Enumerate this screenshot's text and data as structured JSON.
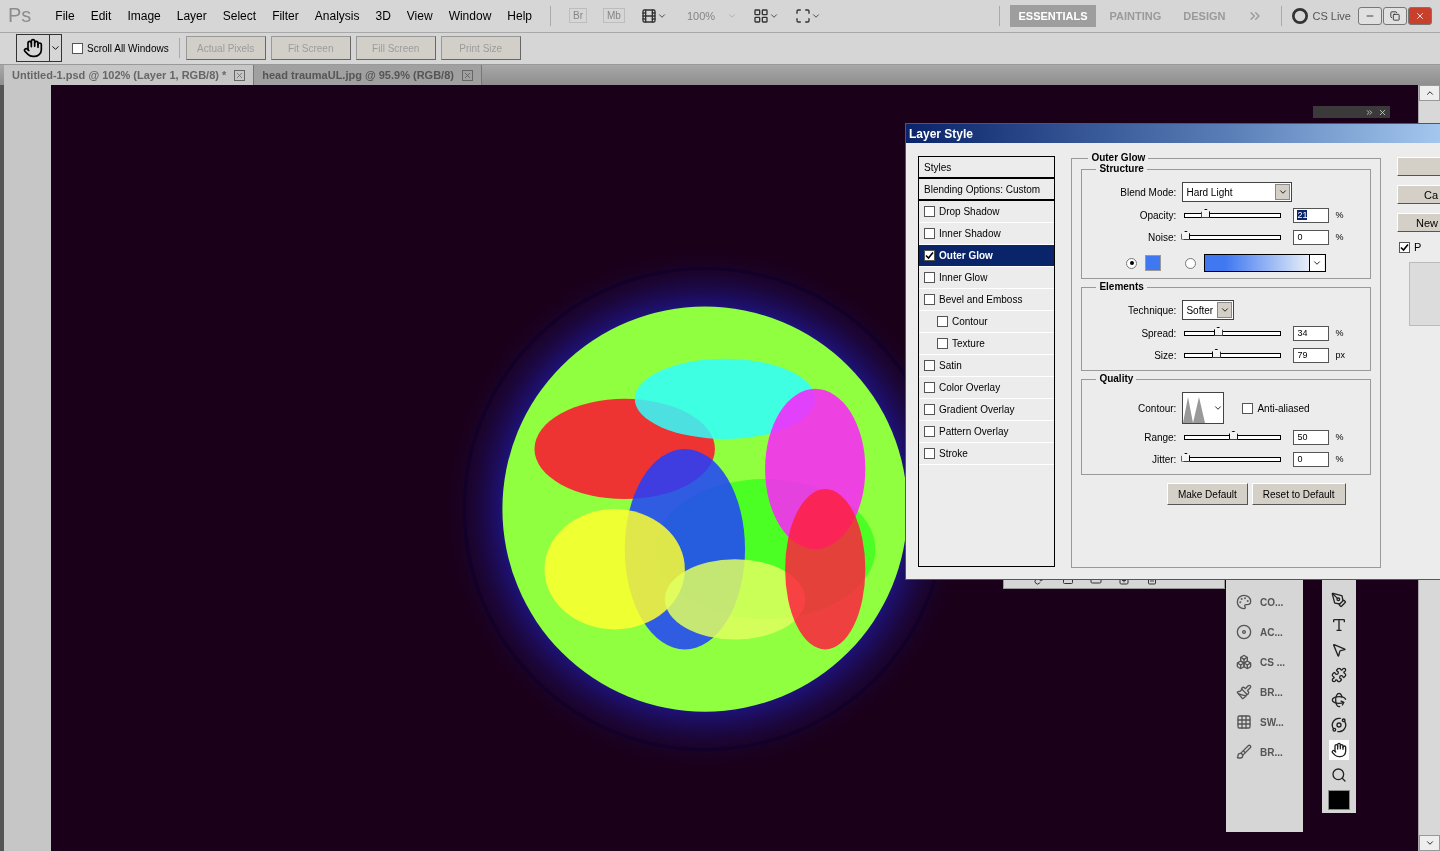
{
  "app": {
    "logo": "Ps",
    "menu": [
      "File",
      "Edit",
      "Image",
      "Layer",
      "Select",
      "Filter",
      "Analysis",
      "3D",
      "View",
      "Window",
      "Help"
    ],
    "bridge_buttons": [
      {
        "label": "Br",
        "disabled": true
      },
      {
        "label": "Mb",
        "disabled": true
      }
    ],
    "zoom": {
      "value": "100%",
      "disabled": true
    },
    "workspaces": [
      {
        "label": "ESSENTIALS",
        "selected": true
      },
      {
        "label": "PAINTING",
        "selected": false
      },
      {
        "label": "DESIGN",
        "selected": false
      }
    ],
    "cs_live": "CS Live"
  },
  "options_bar": {
    "scroll_all_windows": {
      "label": "Scroll All Windows",
      "checked": false
    },
    "buttons": [
      {
        "label": "Actual Pixels",
        "disabled": true
      },
      {
        "label": "Fit Screen",
        "disabled": true
      },
      {
        "label": "Fill Screen",
        "disabled": true
      },
      {
        "label": "Print Size",
        "disabled": true
      }
    ]
  },
  "tabs": [
    {
      "label": "Untitled-1.psd @ 102% (Layer 1, RGB/8) *",
      "selected": true
    },
    {
      "label": "head traumaUL.jpg @ 95.9% (RGB/8)",
      "selected": false
    }
  ],
  "dialog": {
    "title": "Layer Style",
    "styles": [
      {
        "label": "Styles",
        "kind": "header",
        "selected": false
      },
      {
        "label": "Blending Options: Custom",
        "kind": "header",
        "selected": false
      },
      {
        "label": "Drop Shadow",
        "kind": "effect",
        "checked": false,
        "selected": false
      },
      {
        "label": "Inner Shadow",
        "kind": "effect",
        "checked": false,
        "selected": false
      },
      {
        "label": "Outer Glow",
        "kind": "effect",
        "checked": true,
        "selected": true
      },
      {
        "label": "Inner Glow",
        "kind": "effect",
        "checked": false,
        "selected": false
      },
      {
        "label": "Bevel and Emboss",
        "kind": "effect",
        "checked": false,
        "selected": false,
        "children": [
          {
            "label": "Contour",
            "kind": "effect",
            "checked": false,
            "selected": false
          },
          {
            "label": "Texture",
            "kind": "effect",
            "checked": false,
            "selected": false
          }
        ]
      },
      {
        "label": "Satin",
        "kind": "effect",
        "checked": false,
        "selected": false
      },
      {
        "label": "Color Overlay",
        "kind": "effect",
        "checked": false,
        "selected": false
      },
      {
        "label": "Gradient Overlay",
        "kind": "effect",
        "checked": false,
        "selected": false
      },
      {
        "label": "Pattern Overlay",
        "kind": "effect",
        "checked": false,
        "selected": false
      },
      {
        "label": "Stroke",
        "kind": "effect",
        "checked": false,
        "selected": false
      }
    ],
    "panel_title": "Outer Glow",
    "structure": {
      "title": "Structure",
      "blend_mode": {
        "label": "Blend Mode:",
        "value": "Hard Light"
      },
      "sliders": [
        {
          "label": "Opacity:",
          "level": 0.21,
          "value": "21",
          "unit": "%",
          "text_selected": true
        },
        {
          "label": "Noise:",
          "level": 0,
          "value": "0",
          "unit": "%",
          "text_selected": false
        }
      ],
      "fill_options": [
        {
          "kind": "solid",
          "selected": true,
          "color": "#3f78f0"
        },
        {
          "kind": "gradient",
          "selected": false,
          "color": "#3f78f0"
        }
      ]
    },
    "elements": {
      "title": "Elements",
      "technique": {
        "label": "Technique:",
        "value": "Softer"
      },
      "sliders": [
        {
          "label": "Spread:",
          "level": 0.34,
          "value": "34",
          "unit": "%",
          "text_selected": false
        },
        {
          "label": "Size:",
          "level": 0.32,
          "value": "79",
          "unit": "px",
          "text_selected": false
        }
      ]
    },
    "quality": {
      "title": "Quality",
      "contour_label": "Contour:",
      "anti_aliased": {
        "label": "Anti-aliased",
        "checked": false
      },
      "sliders": [
        {
          "label": "Range:",
          "level": 0.5,
          "value": "50",
          "unit": "%",
          "text_selected": false
        },
        {
          "label": "Jitter:",
          "level": 0,
          "value": "0",
          "unit": "%",
          "text_selected": false
        }
      ]
    },
    "buttons": [
      "Make Default",
      "Reset to Default"
    ],
    "side_buttons": [
      "Ca",
      "New"
    ],
    "preview": {
      "label": "P",
      "checked": true
    }
  },
  "panels": [
    "CO...",
    "AC...",
    "CS ...",
    "BR...",
    "SW...",
    "BR..."
  ]
}
